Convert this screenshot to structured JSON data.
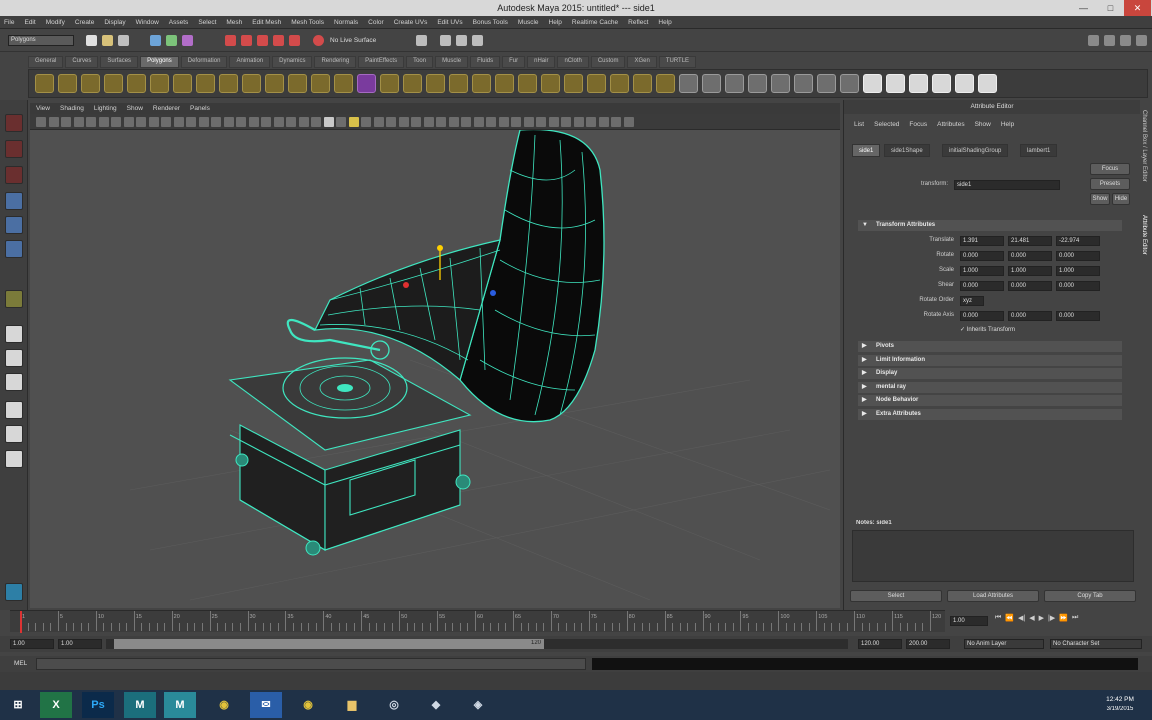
{
  "window": {
    "title": "Autodesk Maya 2015: untitled* --- side1",
    "min_label": "—",
    "max_label": "□",
    "close_label": "✕"
  },
  "menubar": [
    "File",
    "Edit",
    "Modify",
    "Create",
    "Display",
    "Window",
    "Assets",
    "Select",
    "Mesh",
    "Edit Mesh",
    "Mesh Tools",
    "Normals",
    "Color",
    "Create UVs",
    "Edit UVs",
    "Bonus Tools",
    "Muscle",
    "Help",
    "Realtime Cache",
    "Reflect",
    "Help"
  ],
  "statusline": {
    "mode": "Polygons",
    "live_surface": "No Live Surface"
  },
  "shelf": {
    "tabs": [
      "General",
      "Curves",
      "Surfaces",
      "Polygons",
      "Deformation",
      "Animation",
      "Dynamics",
      "Rendering",
      "PaintEffects",
      "Toon",
      "Muscle",
      "Fluids",
      "Fur",
      "nHair",
      "nCloth",
      "Custom",
      "XGen",
      "TURTLE"
    ],
    "active_tab": "Polygons"
  },
  "viewport": {
    "menus": [
      "View",
      "Shading",
      "Lighting",
      "Show",
      "Renderer",
      "Panels"
    ],
    "wire_color": "#3fe6c0",
    "background_color": "#505050"
  },
  "attribute_editor": {
    "title": "Attribute Editor",
    "menus": [
      "List",
      "Selected",
      "Focus",
      "Attributes",
      "Show",
      "Help"
    ],
    "tabs": [
      "side1",
      "side1Shape",
      "initialShadingGroup",
      "lambert1"
    ],
    "active_tab": "side1",
    "focus_button": "Focus",
    "presets_button": "Presets",
    "show_button": "Show",
    "hide_button": "Hide",
    "transform_label": "transform:",
    "transform_value": "side1",
    "section_open": "Transform Attributes",
    "rows": [
      {
        "label": "Translate",
        "values": [
          "1.391",
          "21.481",
          "-22.974"
        ]
      },
      {
        "label": "Rotate",
        "values": [
          "0.000",
          "0.000",
          "0.000"
        ]
      },
      {
        "label": "Scale",
        "values": [
          "1.000",
          "1.000",
          "1.000"
        ]
      },
      {
        "label": "Shear",
        "values": [
          "0.000",
          "0.000",
          "0.000"
        ]
      },
      {
        "label": "Rotate Order",
        "values": [
          "xyz"
        ]
      },
      {
        "label": "Rotate Axis",
        "values": [
          "0.000",
          "0.000",
          "0.000"
        ]
      }
    ],
    "inherits_label": "Inherits Transform",
    "sections_closed": [
      "Pivots",
      "Limit Information",
      "Display",
      "mental ray",
      "Node Behavior",
      "Extra Attributes"
    ],
    "notes_label": "Notes: side1",
    "buttons": [
      "Select",
      "Load Attributes",
      "Copy Tab"
    ]
  },
  "side_tabs": [
    "Channel Box / Layer Editor",
    "Attribute Editor"
  ],
  "timeline": {
    "ticks": [
      "1",
      "5",
      "10",
      "15",
      "20",
      "25",
      "30",
      "35",
      "40",
      "45",
      "50",
      "55",
      "60",
      "65",
      "70",
      "75",
      "80",
      "85",
      "90",
      "95",
      "100",
      "105",
      "110",
      "115",
      "120"
    ],
    "current_frame": "1.00",
    "start": "1.00",
    "start2": "1.00",
    "range_end": "120",
    "end": "120.00",
    "end2": "200.00",
    "anim_layer": "No Anim Layer",
    "char_set": "No Character Set"
  },
  "cmdline": {
    "label": "MEL"
  },
  "taskbar": {
    "time": "12:42 PM",
    "date": "3/19/2015",
    "apps": [
      "start-icon",
      "excel-icon",
      "photoshop-icon",
      "maya-icon",
      "maya2-icon",
      "chrome-icon",
      "mail-icon",
      "chrome2-icon",
      "folder-icon",
      "network-icon",
      "media-icon",
      "tool-icon"
    ]
  }
}
